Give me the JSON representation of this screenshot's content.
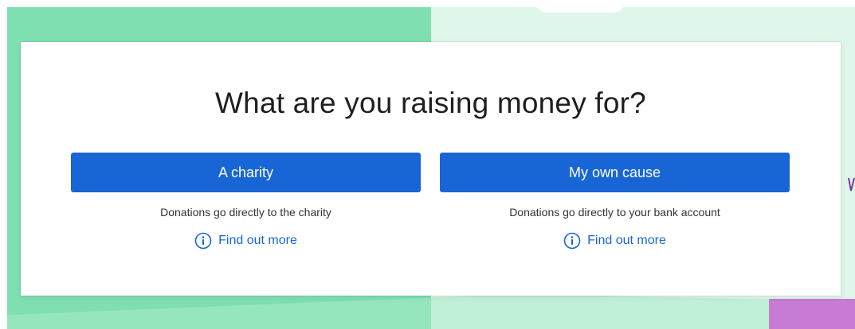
{
  "heading": "What are you raising money for?",
  "options": [
    {
      "button_label": "A charity",
      "description": "Donations go directly to the charity",
      "link_label": "Find out more",
      "link_icon": "info-icon"
    },
    {
      "button_label": "My own cause",
      "description": "Donations go directly to your bank account",
      "link_label": "Find out more",
      "link_icon": "info-icon"
    }
  ],
  "colors": {
    "primary": "#1866d6",
    "background_left": "#7fdfb0",
    "background_right": "#dff6ea",
    "accent_purple": "#c77bd2"
  }
}
